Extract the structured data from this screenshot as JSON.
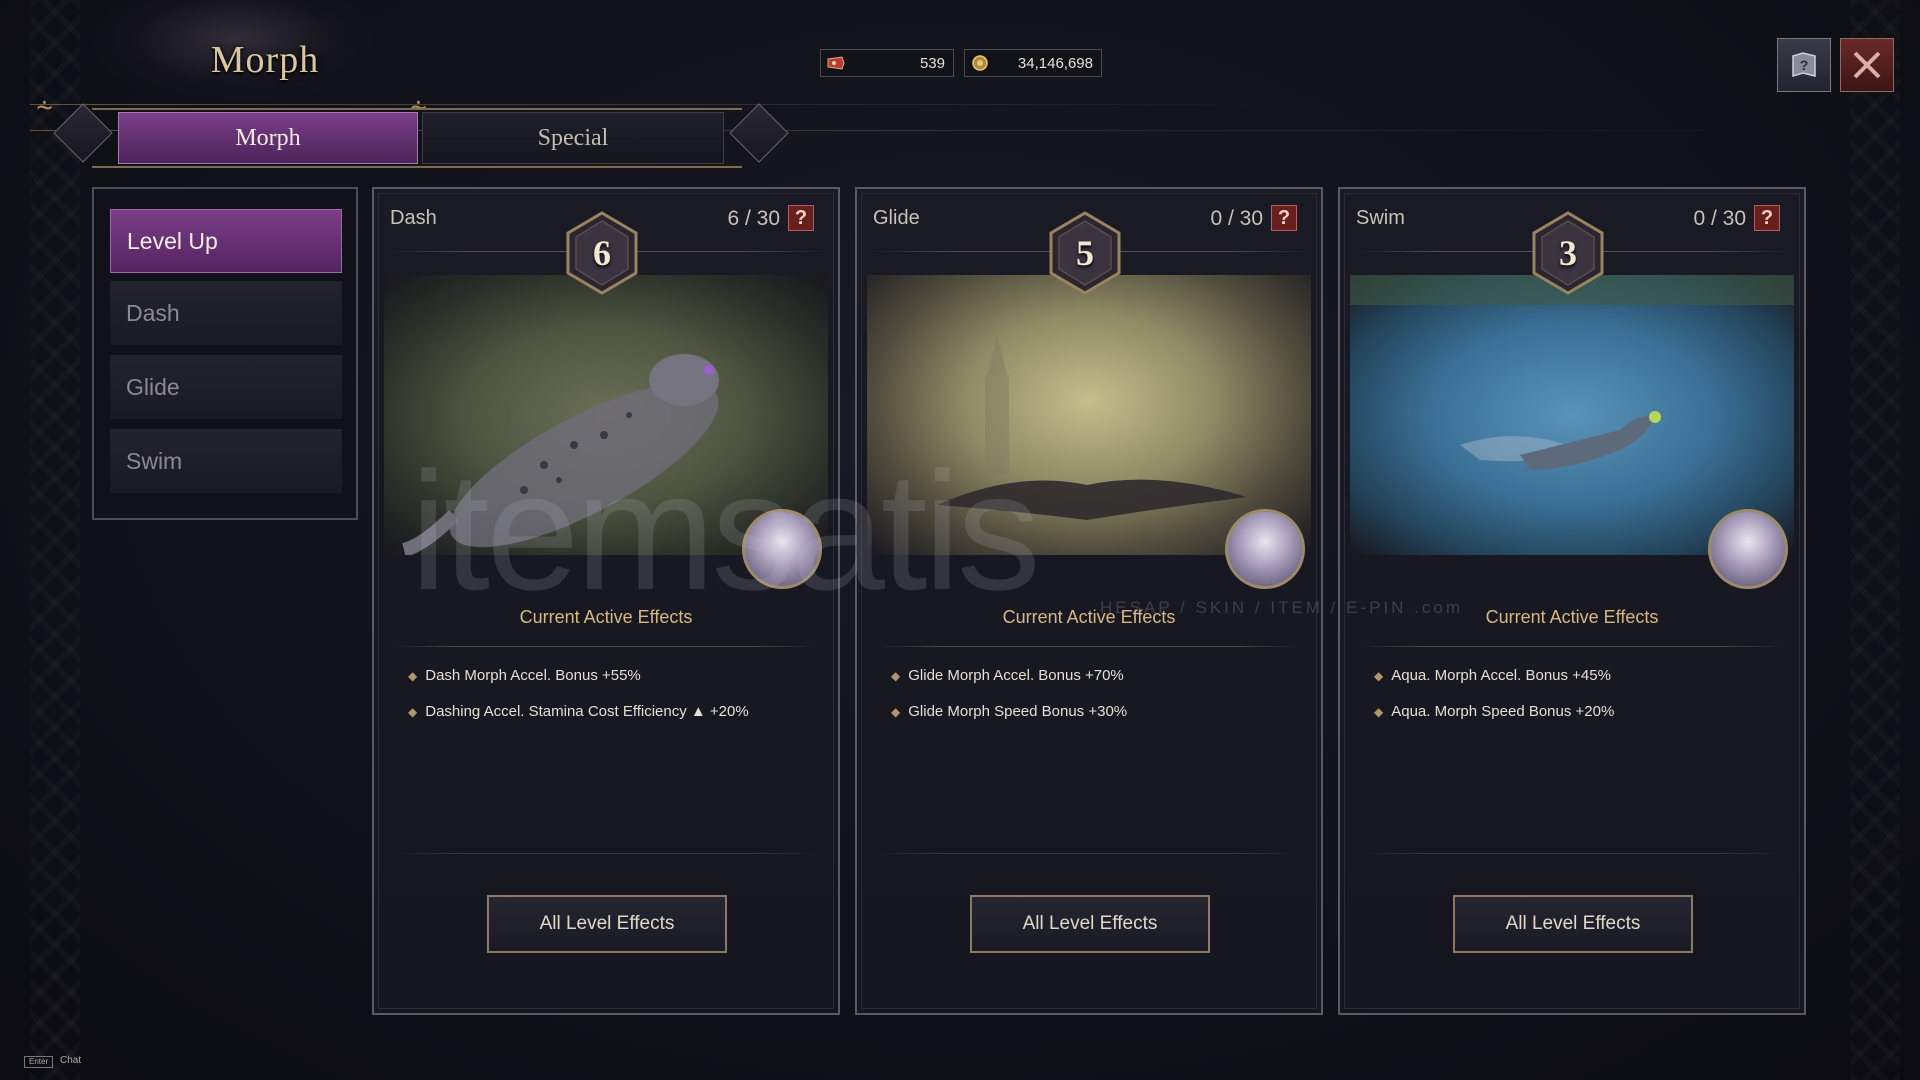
{
  "window": {
    "title": "Morph"
  },
  "currency": [
    {
      "icon": "ticket-icon",
      "value": "539"
    },
    {
      "icon": "gold-coin-icon",
      "value": "34,146,698"
    }
  ],
  "tabs": [
    {
      "label": "Morph",
      "active": true
    },
    {
      "label": "Special",
      "active": false
    }
  ],
  "menu": {
    "items": [
      {
        "label": "Level Up",
        "active": true
      },
      {
        "label": "Dash",
        "active": false
      },
      {
        "label": "Glide",
        "active": false
      },
      {
        "label": "Swim",
        "active": false
      }
    ]
  },
  "cards": [
    {
      "name": "Dash",
      "level": "6",
      "count": "6 / 30",
      "help": "?",
      "effects_title": "Current Active Effects",
      "effects": [
        "Dash Morph Accel. Bonus +55%",
        "Dashing Accel. Stamina Cost Efficiency ▲ +20%"
      ],
      "button": "All Level Effects"
    },
    {
      "name": "Glide",
      "level": "5",
      "count": "0 / 30",
      "help": "?",
      "effects_title": "Current Active Effects",
      "effects": [
        "Glide Morph Accel. Bonus +70%",
        "Glide Morph Speed Bonus  +30%"
      ],
      "button": "All Level Effects"
    },
    {
      "name": "Swim",
      "level": "3",
      "count": "0 / 30",
      "help": "?",
      "effects_title": "Current Active Effects",
      "effects": [
        "Aqua. Morph Accel. Bonus +45%",
        "Aqua. Morph Speed Bonus +20%"
      ],
      "button": "All Level Effects"
    }
  ],
  "watermark": {
    "brand": "itemsatis",
    "sub": "HESAP / SKIN / ITEM / E-PIN",
    "domain": ".com"
  },
  "chat": {
    "key": "Enter",
    "label": "Chat"
  },
  "colors": {
    "accent_purple": "#7c3d88",
    "gold_text": "#d7b884",
    "close_red": "#6a2a2a"
  }
}
